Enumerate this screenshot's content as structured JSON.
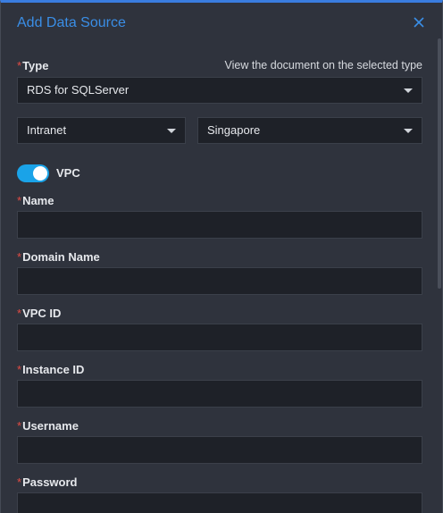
{
  "dialog": {
    "title": "Add Data Source",
    "close_icon": "close-icon"
  },
  "type_field": {
    "label": "Type",
    "required_mark": "*",
    "doc_link": "View the document on the selected type",
    "selected": "RDS for SQLServer"
  },
  "network": {
    "selected": "Intranet"
  },
  "region": {
    "selected": "Singapore"
  },
  "vpc_toggle": {
    "label": "VPC",
    "on": true,
    "accent": "#1aa3e8"
  },
  "fields": {
    "name": {
      "label": "Name",
      "required_mark": "*",
      "value": ""
    },
    "domain": {
      "label": "Domain Name",
      "required_mark": "*",
      "value": ""
    },
    "vpc_id": {
      "label": "VPC ID",
      "required_mark": "*",
      "value": ""
    },
    "instance_id": {
      "label": "Instance ID",
      "required_mark": "*",
      "value": ""
    },
    "username": {
      "label": "Username",
      "required_mark": "*",
      "value": ""
    },
    "password": {
      "label": "Password",
      "required_mark": "*",
      "value": ""
    }
  },
  "colors": {
    "title": "#3a8ee6",
    "required": "#e04b44",
    "panel": "#2f333d",
    "input_bg": "#1e2128"
  }
}
